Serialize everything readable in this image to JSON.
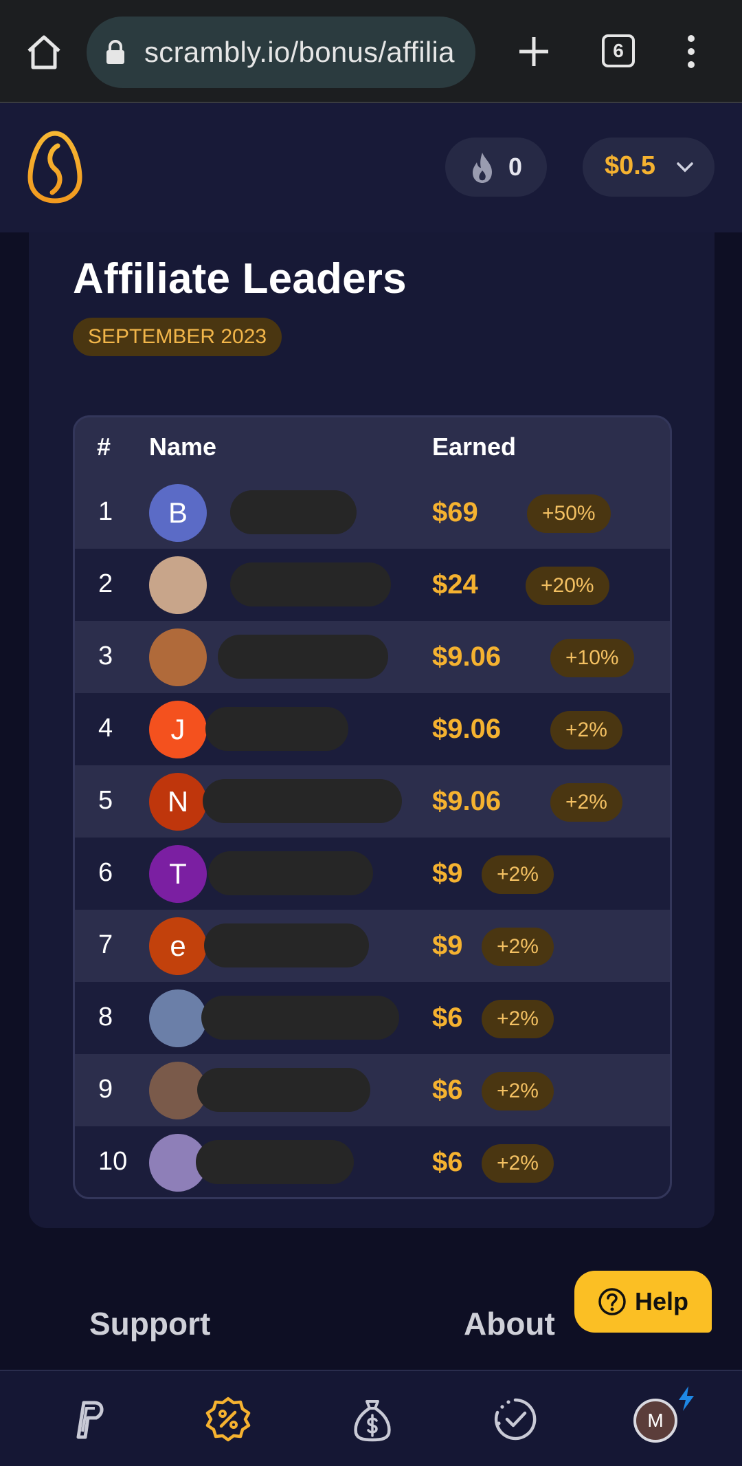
{
  "browser": {
    "url": "scrambly.io/bonus/affilia",
    "tab_count": "6"
  },
  "header": {
    "streak_count": "0",
    "balance": "$0.5"
  },
  "leaderboard": {
    "title": "Affiliate Leaders",
    "month": "SEPTEMBER 2023",
    "columns": {
      "rank": "#",
      "name": "Name",
      "earned": "Earned"
    },
    "rows": [
      {
        "rank": "1",
        "initial": "B",
        "avatar_color": "#5b6bc6",
        "amount": "$69",
        "bonus": "+50%"
      },
      {
        "rank": "2",
        "initial": "",
        "avatar_color": "#c8a58a",
        "amount": "$24",
        "bonus": "+20%"
      },
      {
        "rank": "3",
        "initial": "",
        "avatar_color": "#b06a3a",
        "amount": "$9.06",
        "bonus": "+10%"
      },
      {
        "rank": "4",
        "initial": "J",
        "avatar_color": "#f4511e",
        "amount": "$9.06",
        "bonus": "+2%"
      },
      {
        "rank": "5",
        "initial": "N",
        "avatar_color": "#bf360c",
        "amount": "$9.06",
        "bonus": "+2%"
      },
      {
        "rank": "6",
        "initial": "T",
        "avatar_color": "#7b1fa2",
        "amount": "$9",
        "bonus": "+2%"
      },
      {
        "rank": "7",
        "initial": "e",
        "avatar_color": "#c2410c",
        "amount": "$9",
        "bonus": "+2%"
      },
      {
        "rank": "8",
        "initial": "",
        "avatar_color": "#6b7fa8",
        "amount": "$6",
        "bonus": "+2%"
      },
      {
        "rank": "9",
        "initial": "",
        "avatar_color": "#7a5a4a",
        "amount": "$6",
        "bonus": "+2%"
      },
      {
        "rank": "10",
        "initial": "",
        "avatar_color": "#8e7fb8",
        "amount": "$6",
        "bonus": "+2%"
      }
    ]
  },
  "footer": {
    "support": "Support",
    "about": "About",
    "help": "Help"
  },
  "bottom_nav": {
    "profile_initial": "M"
  },
  "colors": {
    "accent": "#f5b230",
    "help": "#fbbf24",
    "background": "#0e0f24",
    "card": "#171936"
  }
}
